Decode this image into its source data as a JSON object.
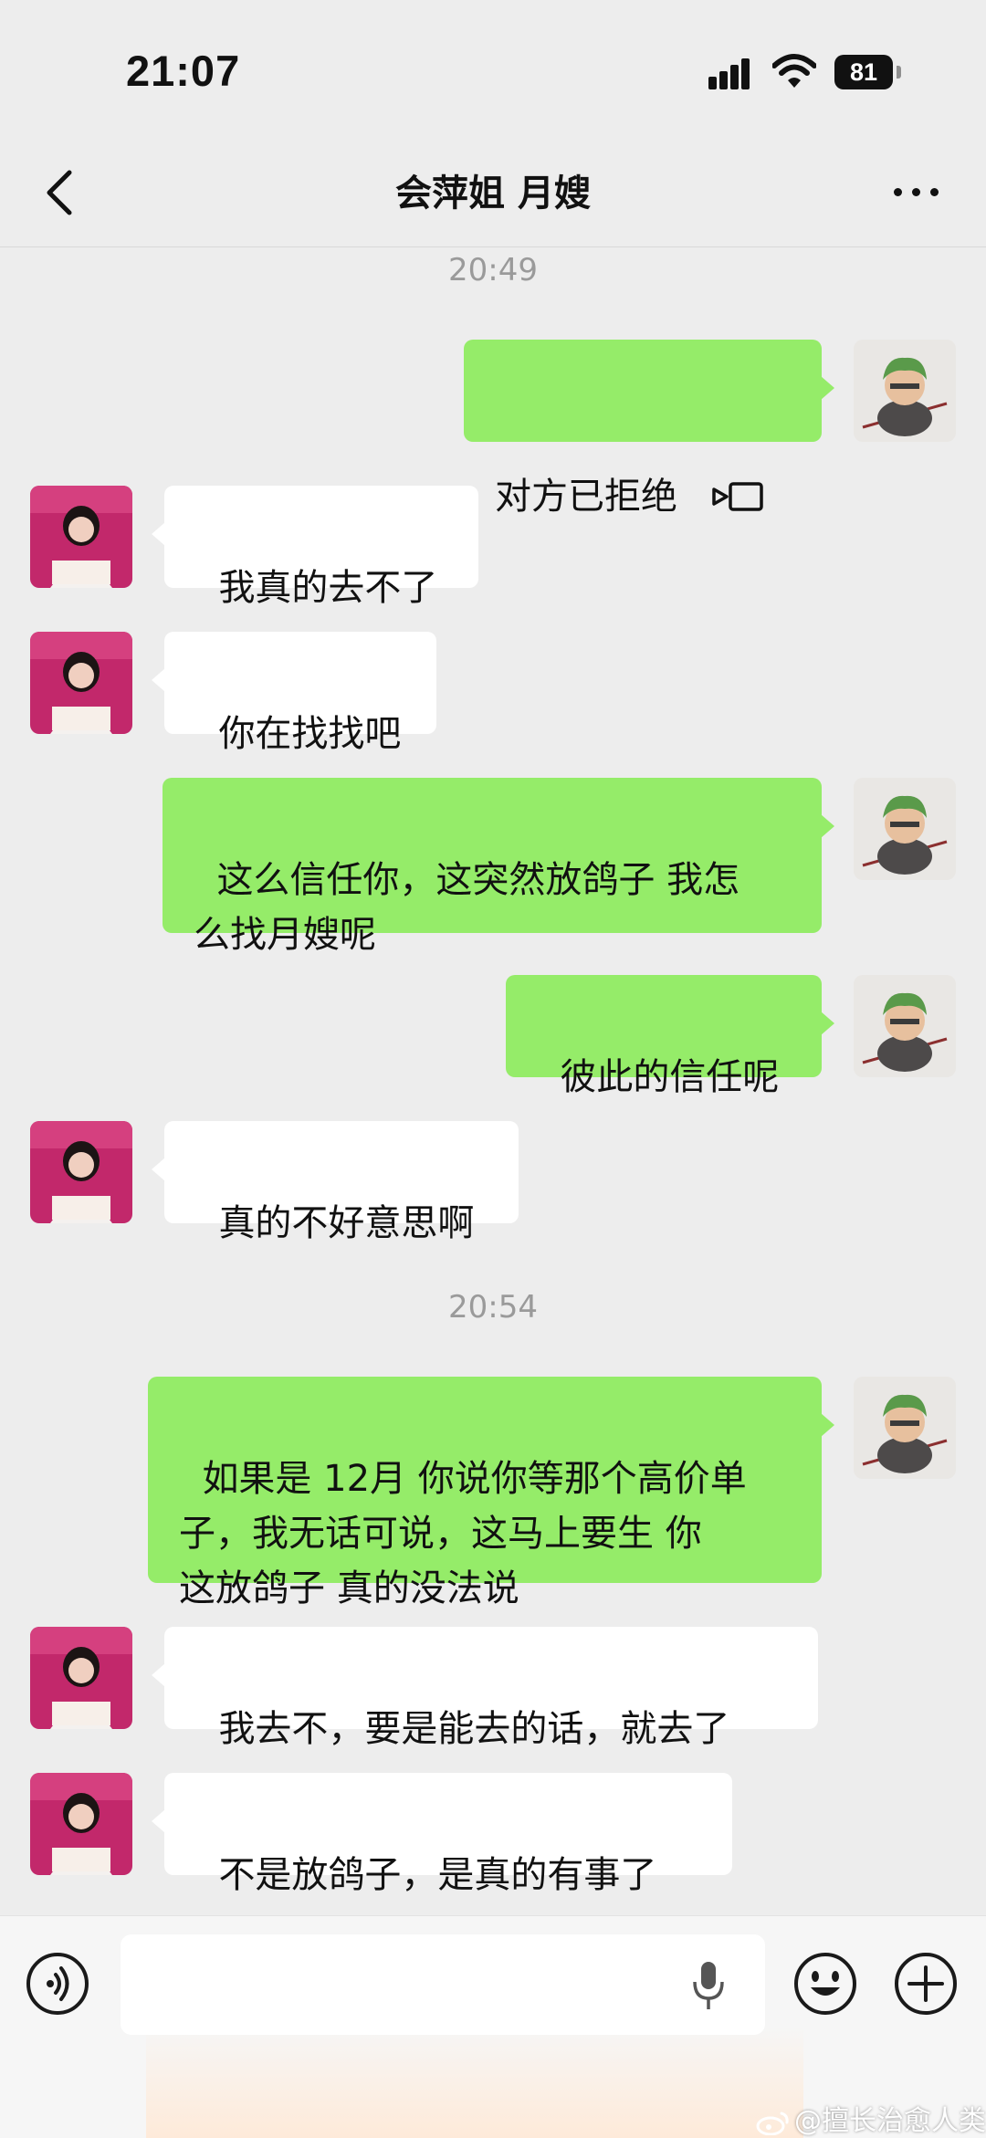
{
  "status_bar": {
    "time": "21:07",
    "battery": "81"
  },
  "nav": {
    "title": "会萍姐 月嫂"
  },
  "timestamps": [
    "20:49",
    "20:54"
  ],
  "messages": [
    {
      "sender": "me",
      "text": "对方已拒绝",
      "icon": "video-call-icon"
    },
    {
      "sender": "contact",
      "text": "我真的去不了"
    },
    {
      "sender": "contact",
      "text": "你在找找吧"
    },
    {
      "sender": "me",
      "text": "这么信任你，这突然放鸽子 我怎\n么找月嫂呢"
    },
    {
      "sender": "me",
      "text": "彼此的信任呢"
    },
    {
      "sender": "contact",
      "text": "真的不好意思啊"
    },
    {
      "sender": "me",
      "text": "如果是 12月 你说你等那个高价单\n子，我无话可说，这马上要生 你\n这放鸽子 真的没法说"
    },
    {
      "sender": "contact",
      "text": "我去不，要是能去的话，就去了"
    },
    {
      "sender": "contact",
      "text": "不是放鸽子，是真的有事了"
    }
  ],
  "input": {
    "value": "",
    "placeholder": ""
  },
  "watermark": "@擅长治愈人类",
  "colors": {
    "background": "#ededed",
    "outgoing_bubble": "#95ec69",
    "incoming_bubble": "#ffffff",
    "timestamp": "#9a9a9a"
  }
}
